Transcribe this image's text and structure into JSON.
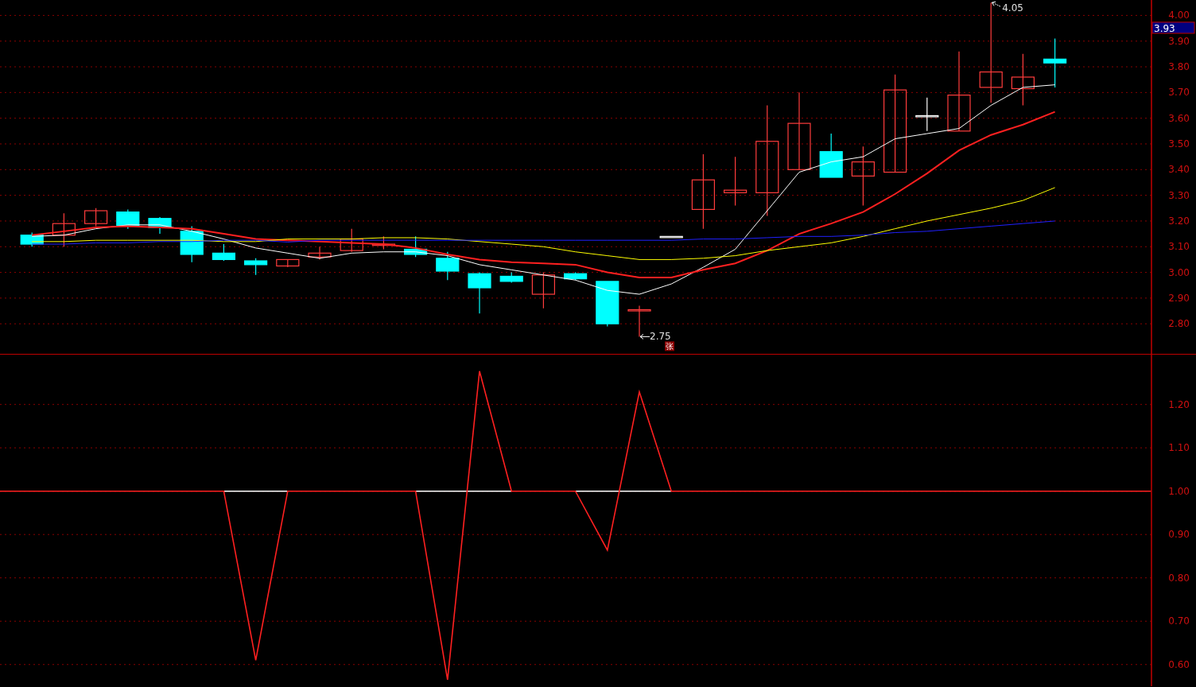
{
  "price_panel": {
    "low_badge": {
      "text": "张"
    },
    "chart_data": {
      "type": "line",
      "grid": true,
      "ylim": [
        2.68,
        4.06
      ],
      "yticks": [
        {
          "value": 2.8,
          "label": "2.80"
        },
        {
          "value": 2.9,
          "label": "2.90"
        },
        {
          "value": 3.0,
          "label": "3.00"
        },
        {
          "value": 3.1,
          "label": "3.10"
        },
        {
          "value": 3.2,
          "label": "3.20"
        },
        {
          "value": 3.3,
          "label": "3.30"
        },
        {
          "value": 3.4,
          "label": "3.40"
        },
        {
          "value": 3.5,
          "label": "3.50"
        },
        {
          "value": 3.6,
          "label": "3.60"
        },
        {
          "value": 3.7,
          "label": "3.70"
        },
        {
          "value": 3.8,
          "label": "3.80"
        },
        {
          "value": 3.9,
          "label": "3.90"
        },
        {
          "value": 4.0,
          "label": "4.00"
        }
      ],
      "series": [
        {
          "color": "#ffffff",
          "values": [
            3.14,
            3.145,
            3.17,
            3.185,
            3.185,
            3.16,
            3.13,
            3.095,
            3.075,
            3.055,
            3.075,
            3.08,
            3.08,
            3.065,
            3.03,
            3.01,
            2.99,
            2.97,
            2.93,
            2.915,
            2.955,
            3.02,
            3.09,
            3.24,
            3.39,
            3.43,
            3.45,
            3.52,
            3.54,
            3.56,
            3.65,
            3.72,
            3.73
          ]
        },
        {
          "color": "#ff2020",
          "values": [
            3.145,
            3.16,
            3.175,
            3.18,
            3.175,
            3.17,
            3.15,
            3.13,
            3.125,
            3.12,
            3.115,
            3.11,
            3.095,
            3.07,
            3.05,
            3.04,
            3.035,
            3.03,
            3.0,
            2.98,
            2.98,
            3.01,
            3.035,
            3.085,
            3.15,
            3.19,
            3.235,
            3.305,
            3.385,
            3.475,
            3.535,
            3.575,
            3.625
          ]
        },
        {
          "color": "#ffff00",
          "values": [
            3.12,
            3.12,
            3.125,
            3.125,
            3.125,
            3.125,
            3.12,
            3.12,
            3.13,
            3.13,
            3.13,
            3.135,
            3.135,
            3.13,
            3.12,
            3.11,
            3.1,
            3.08,
            3.065,
            3.05,
            3.05,
            3.055,
            3.065,
            3.085,
            3.1,
            3.115,
            3.14,
            3.17,
            3.2,
            3.225,
            3.25,
            3.28,
            3.33
          ]
        },
        {
          "color": "#2020ff",
          "values": [
            3.11,
            3.11,
            3.115,
            3.115,
            3.12,
            3.12,
            3.125,
            3.125,
            3.118,
            3.125,
            3.125,
            3.125,
            3.125,
            3.125,
            3.125,
            3.125,
            3.125,
            3.125,
            3.125,
            3.125,
            3.125,
            3.13,
            3.13,
            3.135,
            3.14,
            3.14,
            3.145,
            3.155,
            3.16,
            3.17,
            3.18,
            3.19,
            3.2
          ]
        }
      ],
      "annotations": [
        "4.05",
        "2.75",
        "3.93"
      ]
    }
  },
  "indicator_panel": {
    "chart_data": {
      "type": "line",
      "grid": true,
      "ylim": [
        0.55,
        1.315
      ],
      "yticks": [
        {
          "value": 0.6,
          "label": "0.60"
        },
        {
          "value": 0.7,
          "label": "0.70"
        },
        {
          "value": 0.8,
          "label": "0.80"
        },
        {
          "value": 0.9,
          "label": "0.90"
        },
        {
          "value": 1.0,
          "label": "1.00"
        },
        {
          "value": 1.1,
          "label": "1.10"
        },
        {
          "value": 1.2,
          "label": "1.20"
        }
      ],
      "series": [
        {
          "color": "#ffffff",
          "values": [
            null,
            null,
            null,
            null,
            null,
            null,
            null,
            1.0,
            1.0,
            1.0,
            null,
            null,
            null,
            1.0,
            1.0,
            1.0,
            1.0,
            null,
            1.0,
            1.0,
            1.0,
            1.0,
            null,
            null,
            null,
            null,
            null,
            null,
            null,
            null,
            null,
            null,
            null,
            null,
            null,
            null,
            null
          ]
        },
        {
          "color": "#ff2020",
          "values": [
            1.0,
            1.0,
            1.0,
            1.0,
            1.0,
            1.0,
            1.0,
            1.0,
            0.61,
            1.0,
            1.0,
            1.0,
            1.0,
            1.0,
            0.565,
            1.277,
            1.0,
            1.0,
            1.0,
            0.864,
            1.229,
            1.0,
            1.0,
            1.0,
            1.0,
            1.0,
            1.0,
            1.0,
            1.0,
            1.0,
            1.0,
            1.0,
            1.0,
            1.0,
            1.0,
            1.0,
            1.0
          ]
        }
      ]
    }
  }
}
